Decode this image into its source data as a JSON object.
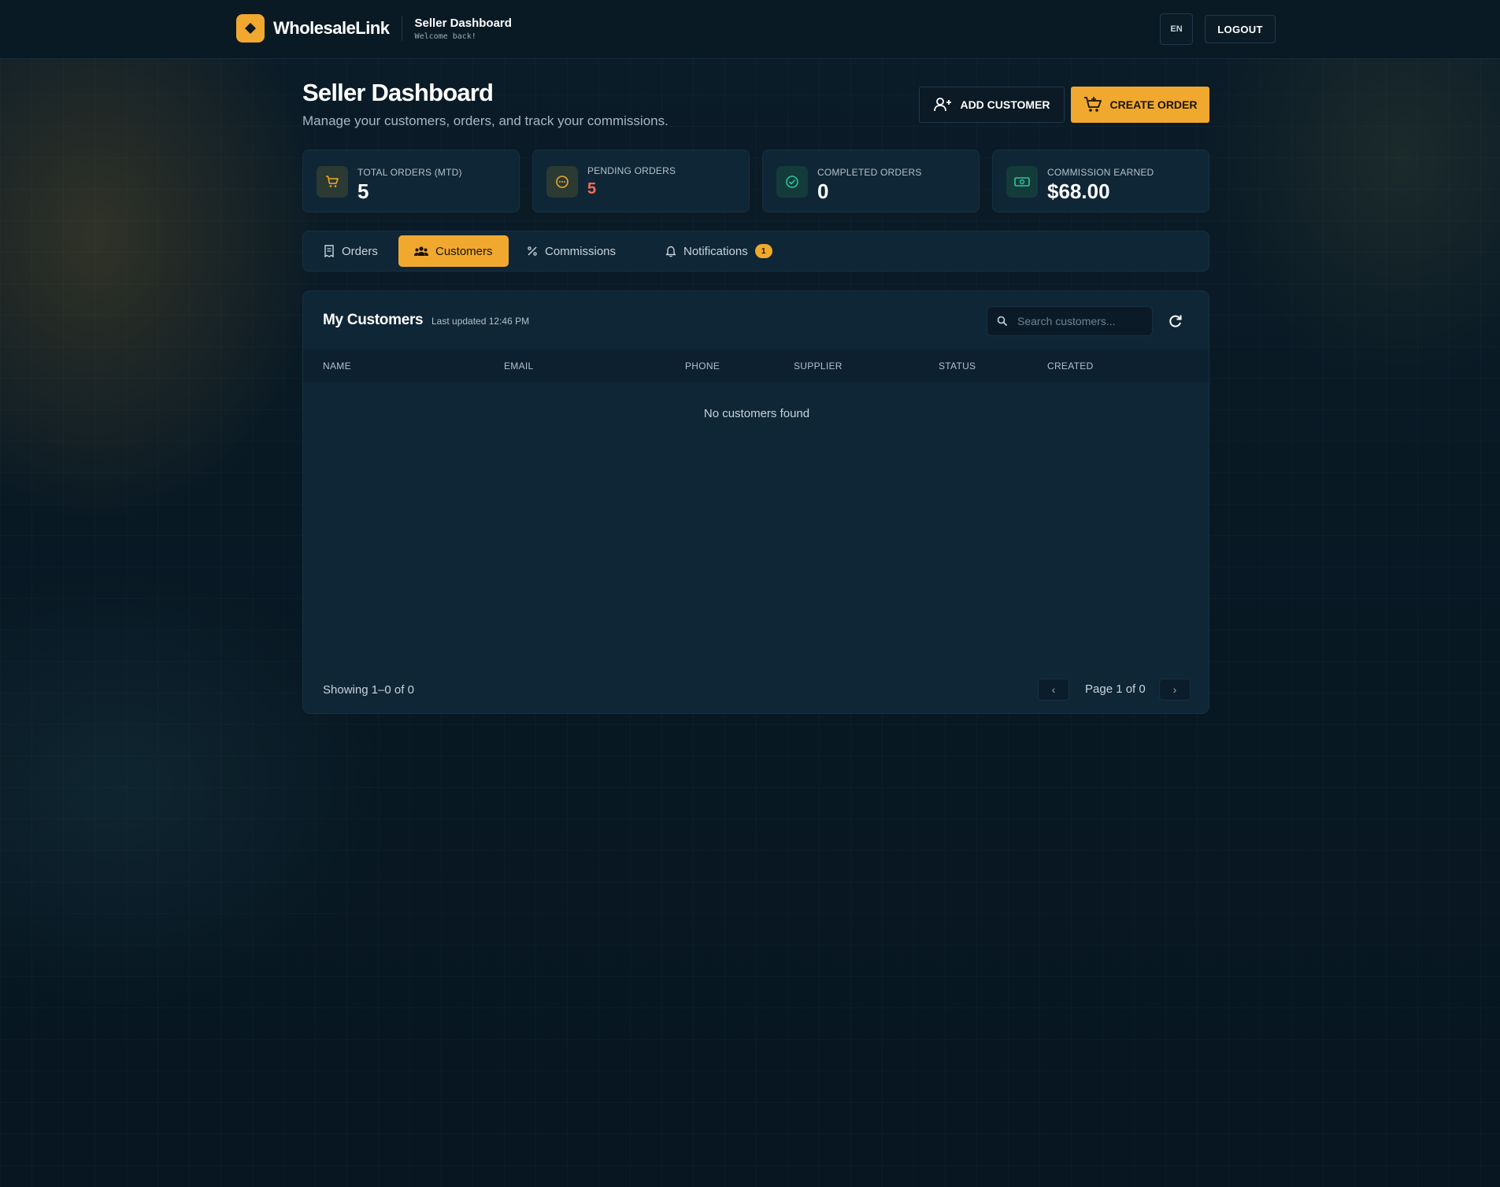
{
  "header": {
    "brand_name": "WholesaleLink",
    "context_title": "Seller Dashboard",
    "context_subtitle": "Welcome back!",
    "lang": "EN",
    "logout_label": "LOGOUT"
  },
  "page": {
    "title": "Seller Dashboard",
    "subtitle": "Manage your customers, orders, and track your commissions.",
    "add_customer_label": "ADD CUSTOMER",
    "create_order_label": "CREATE ORDER"
  },
  "stats": [
    {
      "label": "TOTAL ORDERS (MTD)",
      "value": "5",
      "icon": "cart-icon",
      "color": "#f0a92e"
    },
    {
      "label": "PENDING ORDERS",
      "value": "5",
      "icon": "pending-icon",
      "color": "#ff6b57"
    },
    {
      "label": "COMPLETED ORDERS",
      "value": "0",
      "icon": "check-circle-icon",
      "color": "#2cc6a0"
    },
    {
      "label": "COMMISSION EARNED",
      "value": "$68.00",
      "icon": "cash-icon",
      "color": "#2cc6a0"
    }
  ],
  "tabs": [
    {
      "label": "Orders",
      "icon": "receipt-icon",
      "active": false
    },
    {
      "label": "Customers",
      "icon": "users-icon",
      "active": true
    },
    {
      "label": "Commissions",
      "icon": "percent-icon",
      "active": false
    },
    {
      "label": "Notifications",
      "icon": "bell-icon",
      "active": false,
      "badge": "1"
    }
  ],
  "customers": {
    "title": "My Customers",
    "last_updated": "Last updated 12:46 PM",
    "search_placeholder": "Search customers...",
    "columns": [
      "NAME",
      "EMAIL",
      "PHONE",
      "SUPPLIER",
      "STATUS",
      "CREATED"
    ],
    "rows": [],
    "empty_message": "No customers found",
    "showing": "Showing 1–0 of 0",
    "page_info": "Page 1 of 0",
    "prev": "‹",
    "next": "›"
  },
  "colors": {
    "accent": "#f0a92e",
    "background": "#081823",
    "card": "#0f2636"
  }
}
